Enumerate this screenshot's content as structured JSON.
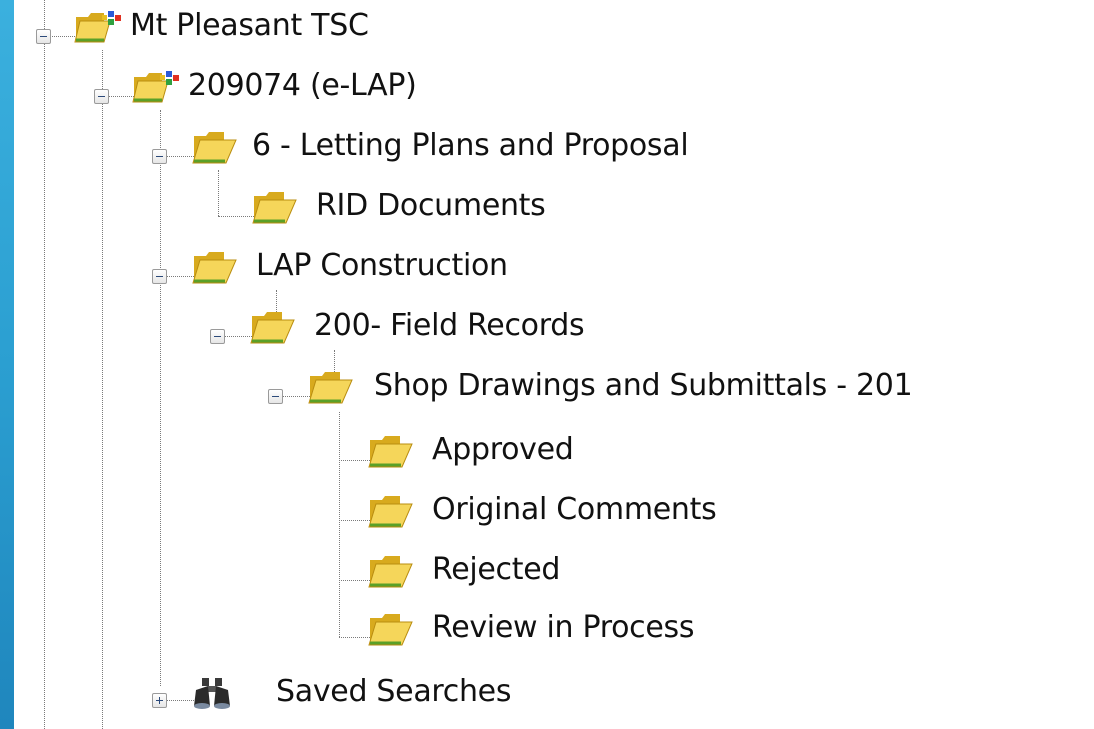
{
  "tree": {
    "nodes": [
      {
        "label": "Mt Pleasant TSC",
        "icon": "project-folder-icon",
        "expanded": true
      },
      {
        "label": "209074 (e-LAP)",
        "icon": "project-folder-icon",
        "expanded": true
      },
      {
        "label": "6 - Letting Plans and Proposal",
        "icon": "folder-icon",
        "expanded": true
      },
      {
        "label": "RID Documents",
        "icon": "folder-icon"
      },
      {
        "label": "LAP Construction",
        "icon": "folder-icon",
        "expanded": true
      },
      {
        "label": "200- Field Records",
        "icon": "folder-icon",
        "expanded": true
      },
      {
        "label": "Shop Drawings and Submittals - 201",
        "icon": "folder-icon",
        "expanded": true
      },
      {
        "label": "Approved",
        "icon": "folder-icon"
      },
      {
        "label": "Original Comments",
        "icon": "folder-icon"
      },
      {
        "label": "Rejected",
        "icon": "folder-icon"
      },
      {
        "label": "Review in Process",
        "icon": "folder-icon"
      },
      {
        "label": "Saved Searches",
        "icon": "binoculars-icon",
        "expanded": false
      }
    ]
  },
  "colors": {
    "folder": "#f2d04a",
    "folder_dark": "#c99a12",
    "frame": "#2aa3d4"
  }
}
